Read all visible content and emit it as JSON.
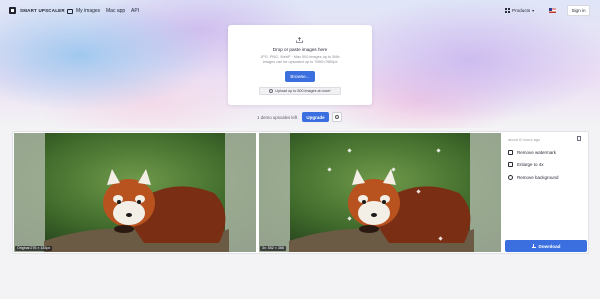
{
  "nav": {
    "logo": "SMART UPSCALER",
    "links": [
      "My images",
      "Mac app",
      "API"
    ],
    "products": "Products",
    "signin": "Sign in"
  },
  "upload": {
    "title": "Drop or paste images here",
    "subtitle_line1": "JPG, PNG, WebP · Max 500 images up to 5Mb",
    "subtitle_line2": "Images can be upscaled up to 7680×7680px",
    "browse": "Browse...",
    "bulk": "Upload up to 500 images at once!"
  },
  "credits": {
    "text": "1 demo upscales left",
    "upgrade": "Upgrade"
  },
  "result": {
    "original_label": "Original 276 × 183px",
    "upscaled_label": "3x: 552 × 366",
    "time": "about 6 hours ago",
    "options": [
      "Remove watermark",
      "Enlarge to 4x",
      "Remove background"
    ],
    "download": "Download"
  },
  "colors": {
    "accent": "#3b6fe0"
  }
}
